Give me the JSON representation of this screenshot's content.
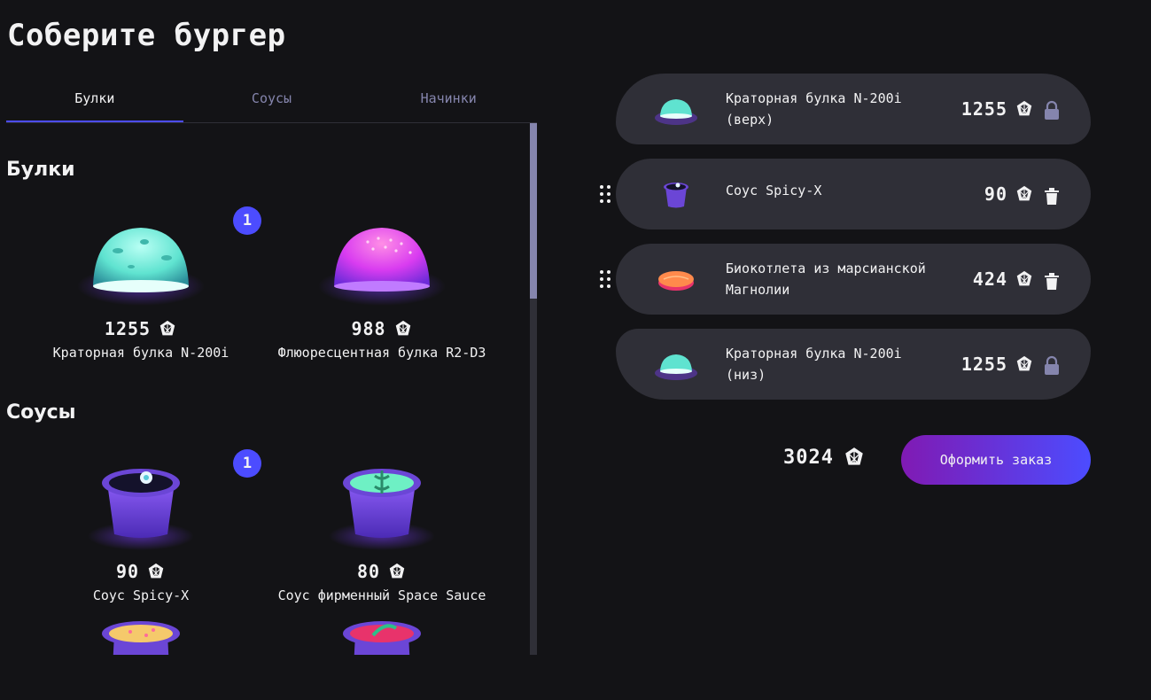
{
  "page_title": "Соберите бургер",
  "tabs": [
    {
      "label": "Булки",
      "active": true
    },
    {
      "label": "Соусы",
      "active": false
    },
    {
      "label": "Начинки",
      "active": false
    }
  ],
  "sections": [
    {
      "title": "Булки",
      "items": [
        {
          "price": "1255",
          "name": "Краторная булка N-200i",
          "count": "1",
          "image": "bun-teal"
        },
        {
          "price": "988",
          "name": "Флюоресцентная булка R2-D3",
          "count": "",
          "image": "bun-pink"
        }
      ]
    },
    {
      "title": "Соусы",
      "items": [
        {
          "price": "90",
          "name": "Соус Spicy-X",
          "count": "1",
          "image": "sauce-dark"
        },
        {
          "price": "80",
          "name": "Соус фирменный Space Sauce",
          "count": "",
          "image": "sauce-green"
        },
        {
          "price": "",
          "name": "",
          "count": "",
          "image": "sauce-yellow"
        },
        {
          "price": "",
          "name": "",
          "count": "",
          "image": "sauce-red"
        }
      ]
    }
  ],
  "constructor": {
    "items": [
      {
        "name": "Краторная булка N-200i (верх)",
        "price": "1255",
        "action": "lock-icon",
        "image": "bun-teal"
      },
      {
        "name": "Соус Spicy-X",
        "price": "90",
        "action": "trash-icon",
        "image": "sauce-dark"
      },
      {
        "name": "Биокотлета из марсианской Магнолии",
        "price": "424",
        "action": "trash-icon",
        "image": "patty"
      },
      {
        "name": "Краторная булка N-200i (низ)",
        "price": "1255",
        "action": "lock-icon",
        "image": "bun-teal"
      }
    ],
    "total": "3024",
    "order_button": "Оформить заказ"
  },
  "colors": {
    "accent": "#4c4cff",
    "background": "#131316",
    "row": "#2f2f37",
    "inactive": "#8585ad"
  },
  "icons": {
    "currency": "currency-icon",
    "lock": "lock-icon",
    "trash": "trash-icon",
    "drag": "drag-icon"
  }
}
